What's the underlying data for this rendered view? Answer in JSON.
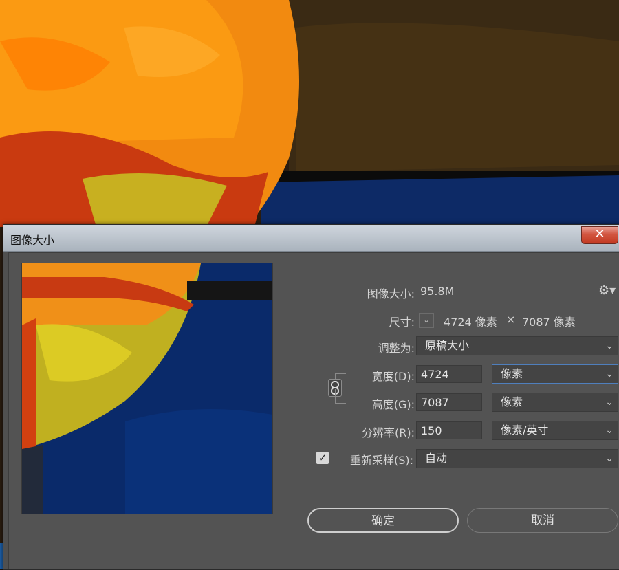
{
  "dialog": {
    "title": "图像大小",
    "close_glyph": "✕"
  },
  "info": {
    "image_size_label": "图像大小:",
    "image_size_value": "95.8M",
    "dimensions_label": "尺寸:",
    "dimensions_width": "4724 像素",
    "dimensions_times": "×",
    "dimensions_height": "7087 像素"
  },
  "fit_to": {
    "label": "调整为:",
    "value": "原稿大小"
  },
  "width": {
    "label": "宽度(D):",
    "value": "4724",
    "unit": "像素"
  },
  "height": {
    "label": "高度(G):",
    "value": "7087",
    "unit": "像素"
  },
  "resolution": {
    "label": "分辨率(R):",
    "value": "150",
    "unit": "像素/英寸"
  },
  "resample": {
    "label": "重新采样(S):",
    "checked": true,
    "value": "自动"
  },
  "buttons": {
    "ok": "确定",
    "cancel": "取消"
  },
  "icons": {
    "gear": "gear-icon",
    "chevron": "chevron-down-icon",
    "link": "link-icon",
    "close": "close-icon",
    "checkmark": "checkmark-icon"
  },
  "colors": {
    "dialog_bg": "#535353",
    "field_bg": "#454545",
    "focus_border": "#4f7fbd"
  }
}
